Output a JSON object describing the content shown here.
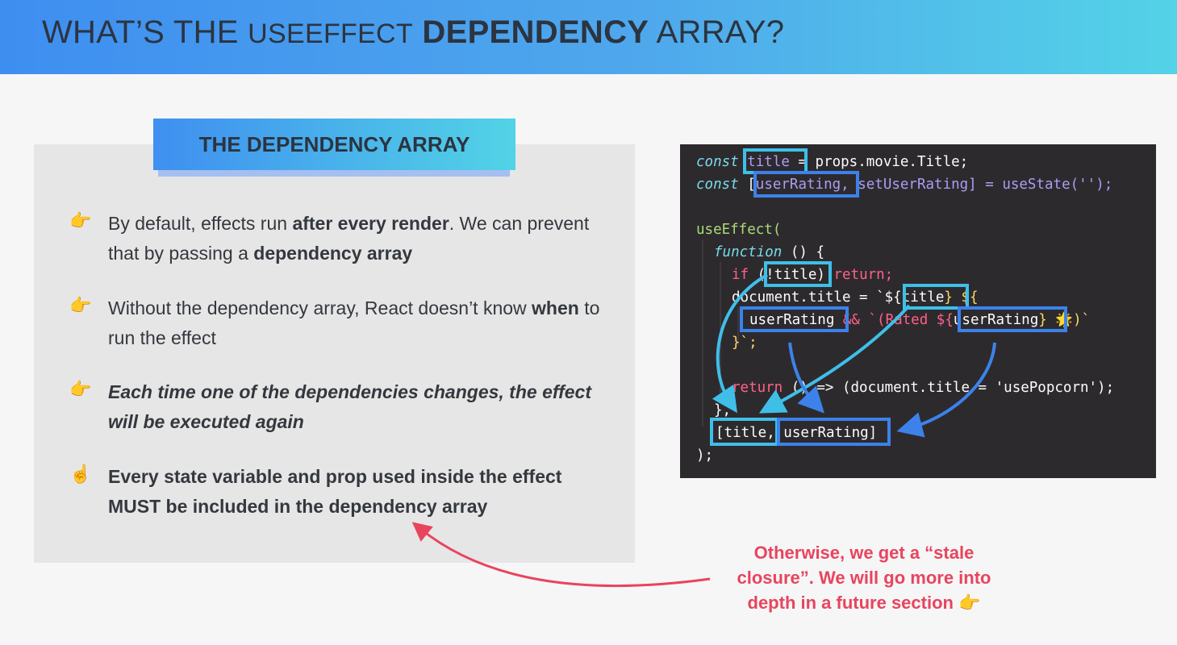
{
  "header": {
    "title_pre": "WHAT’S THE ",
    "title_sc": "USEEFFECT",
    "title_space": " ",
    "title_bold": "DEPENDENCY",
    "title_post": " ARRAY?"
  },
  "panel": {
    "heading": "THE DEPENDENCY ARRAY",
    "bullets": [
      {
        "icon": "👉",
        "t1": "By default, effects run ",
        "b1": "after every render",
        "t2": ". We can prevent that by passing a ",
        "b2": "dependency array"
      },
      {
        "icon": "👉",
        "t1": "Without the dependency array, React doesn’t know ",
        "b1": "when",
        "t2": " to run the effect"
      },
      {
        "icon": "👉",
        "t1": "Each time one of the dependencies changes, the effect will be executed again"
      },
      {
        "icon": "☝️",
        "b0": "Every ",
        "b1": "state variable",
        "b2": " and ",
        "b3": "prop",
        "b4": " used inside the effect ",
        "b5": "MUST",
        "b6": " be included in the dependency array"
      }
    ]
  },
  "code": {
    "l1": {
      "kw": "const",
      "id": "title",
      "rest": " = props.movie.Title;"
    },
    "l2": {
      "kw": "const",
      "open": "[",
      "id": "userRating",
      "rest": ", setUserRating] = useState('');"
    },
    "l4": {
      "fn": "useEffect("
    },
    "l5": {
      "kw": "function",
      "rest": " () {"
    },
    "l6": {
      "kw": "if",
      "open": " (",
      "id": "!title",
      "close": ")",
      "rest": " return;"
    },
    "l7": {
      "rest": "document.title = `${",
      "id": "title",
      "tail": "} ${"
    },
    "l8": {
      "id": "userRating",
      "mid": " && `(Rated ${",
      "id2": "userRating",
      "tail": "} 🌟)`"
    },
    "l9": {
      "rest": "}`;"
    },
    "l11": {
      "kw": "return",
      "rest": " () => (document.title = 'usePopcorn');"
    },
    "l12": {
      "rest": "},"
    },
    "l13": {
      "a": "[title",
      "b": "userRating]"
    },
    "l14": {
      "rest": ");"
    }
  },
  "note": {
    "t1": "Otherwise, we get a “",
    "b1": "stale closure",
    "t2": "”. We will go more into depth in a future section ",
    "icon": "👉"
  },
  "colors": {
    "accent_blue": "#3e8ef0",
    "accent_cyan": "#53d3e7",
    "note_red": "#e8445e",
    "code_bg": "#2d2a2e"
  }
}
